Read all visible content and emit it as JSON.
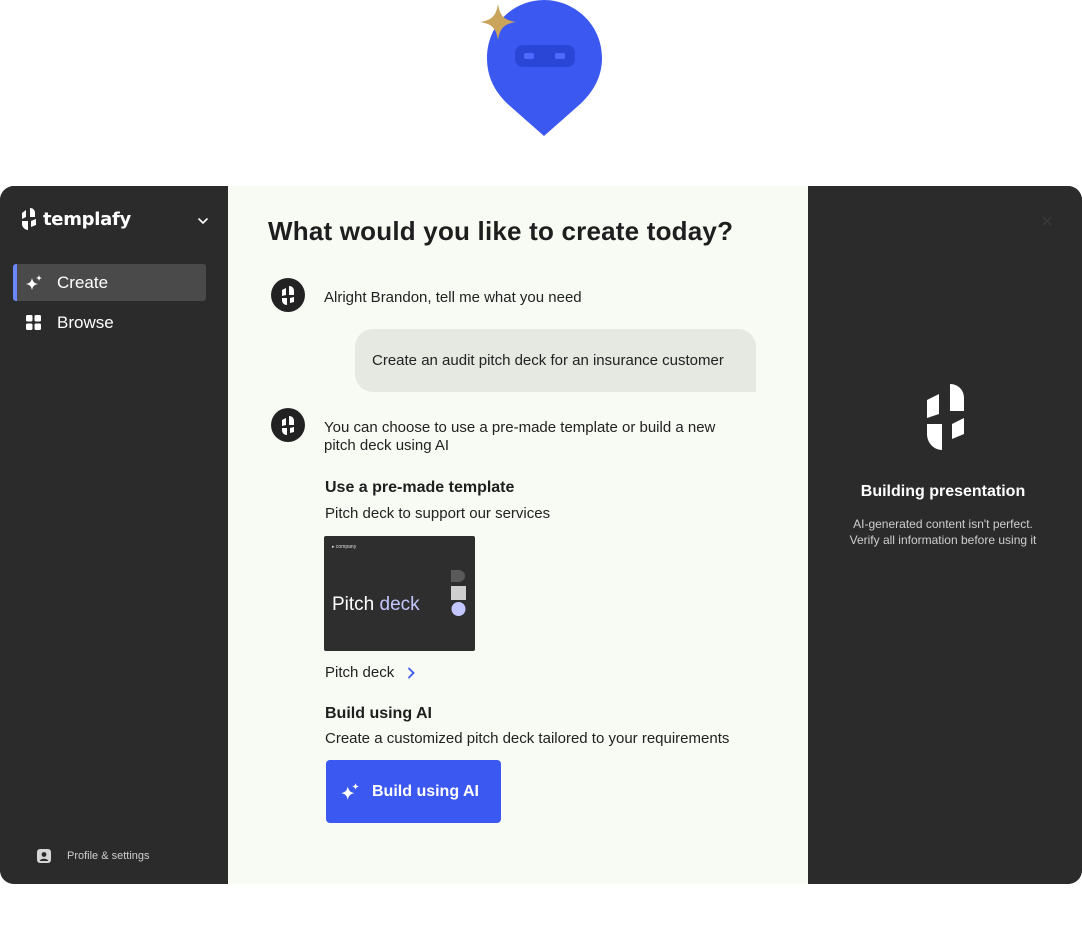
{
  "brand": {
    "name": "templafy"
  },
  "sidebar": {
    "items": [
      {
        "label": "Create",
        "icon": "sparkle-icon",
        "active": true
      },
      {
        "label": "Browse",
        "icon": "grid-icon",
        "active": false
      }
    ],
    "profile_label": "Profile & settings"
  },
  "main": {
    "title": "What would you like to create today?",
    "greeting": "Alright Brandon, tell me what you need",
    "user_prompt": "Create an audit pitch deck for an insurance customer",
    "reply_line1": "You can choose to use a pre-made template or build a new",
    "reply_line2": "pitch deck using AI",
    "template_section": {
      "heading": "Use a pre-made template",
      "subheading": "Pitch deck to support our services",
      "thumbnail_brand": "company",
      "thumbnail_title_plain": "Pitch ",
      "thumbnail_title_accent": "deck",
      "link_label": "Pitch deck"
    },
    "ai_section": {
      "heading": "Build using AI",
      "subheading": "Create a customized pitch deck tailored to your requirements",
      "button_label": "Build using AI"
    }
  },
  "panel": {
    "title": "Building presentation",
    "note_line1": "AI-generated content isn't perfect.",
    "note_line2": "Verify all information before using it"
  },
  "colors": {
    "accent_blue": "#3b58f0",
    "sidebar_bg": "#2b2b2b",
    "main_bg": "#f8faf4",
    "mascot_gold": "#c9a45a"
  }
}
